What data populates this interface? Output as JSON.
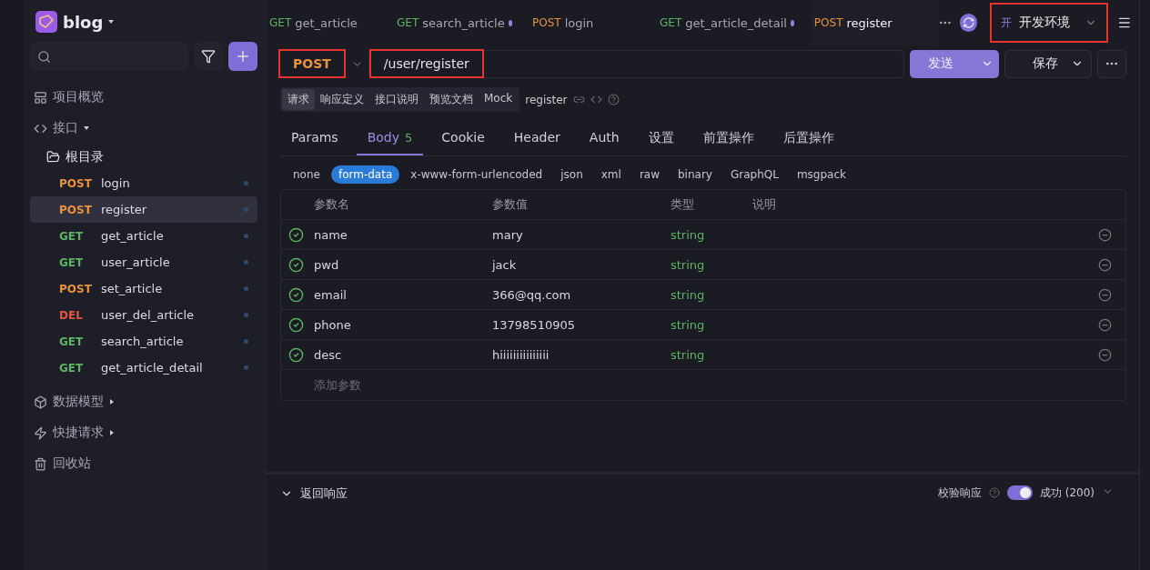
{
  "project": {
    "name": "blog"
  },
  "sidebar": {
    "nav": [
      {
        "label": "项目概览",
        "kind": "overview"
      },
      {
        "label": "接口",
        "kind": "api"
      }
    ],
    "folder": {
      "label": "根目录",
      "children": [
        {
          "method": "POST",
          "name": "login",
          "selected": false
        },
        {
          "method": "POST",
          "name": "register",
          "selected": true
        },
        {
          "method": "GET",
          "name": "get_article",
          "selected": false
        },
        {
          "method": "GET",
          "name": "user_article",
          "selected": false
        },
        {
          "method": "POST",
          "name": "set_article",
          "selected": false
        },
        {
          "method": "DEL",
          "name": "user_del_article",
          "selected": false
        },
        {
          "method": "GET",
          "name": "search_article",
          "selected": false
        },
        {
          "method": "GET",
          "name": "get_article_detail",
          "selected": false
        }
      ]
    },
    "sections": [
      {
        "label": "数据模型",
        "kind": "model"
      },
      {
        "label": "快捷请求",
        "kind": "quick"
      },
      {
        "label": "回收站",
        "kind": "trash"
      }
    ]
  },
  "tabs": [
    {
      "method": "GET",
      "name": "get_article",
      "modified": false,
      "selected": false
    },
    {
      "method": "GET",
      "name": "search_article",
      "modified": true,
      "selected": false
    },
    {
      "method": "POST",
      "name": "login",
      "modified": false,
      "selected": false
    },
    {
      "method": "GET",
      "name": "get_article_detail",
      "modified": true,
      "selected": false
    },
    {
      "method": "POST",
      "name": "register",
      "modified": false,
      "selected": true
    }
  ],
  "environment": {
    "badge": "开",
    "name": "开发环境",
    "highlighted": true
  },
  "request": {
    "method": {
      "value": "POST",
      "highlighted": true
    },
    "url": {
      "value": "/user/register",
      "highlighted": true
    },
    "send": "发送",
    "save": "保存"
  },
  "doc_tabs": [
    {
      "label": "请求",
      "selected": true
    },
    {
      "label": "响应定义",
      "selected": false
    },
    {
      "label": "接口说明",
      "selected": false
    },
    {
      "label": "预览文档",
      "selected": false
    },
    {
      "label": "Mock",
      "selected": false
    }
  ],
  "doc_name": "register",
  "param_tabs": [
    {
      "label": "Params",
      "selected": false
    },
    {
      "label": "Body",
      "count": "5",
      "selected": true
    },
    {
      "label": "Cookie",
      "selected": false
    },
    {
      "label": "Header",
      "selected": false
    },
    {
      "label": "Auth",
      "selected": false
    },
    {
      "label": "设置",
      "selected": false
    },
    {
      "label": "前置操作",
      "selected": false
    },
    {
      "label": "后置操作",
      "selected": false
    }
  ],
  "body_types": [
    {
      "label": "none",
      "selected": false
    },
    {
      "label": "form-data",
      "selected": true
    },
    {
      "label": "x-www-form-urlencoded",
      "selected": false
    },
    {
      "label": "json",
      "selected": false
    },
    {
      "label": "xml",
      "selected": false
    },
    {
      "label": "raw",
      "selected": false
    },
    {
      "label": "binary",
      "selected": false
    },
    {
      "label": "GraphQL",
      "selected": false
    },
    {
      "label": "msgpack",
      "selected": false
    }
  ],
  "table": {
    "columns": [
      "参数名",
      "参数值",
      "类型",
      "说明"
    ],
    "rows": [
      {
        "checked": true,
        "name": "name",
        "value": "mary",
        "type": "string"
      },
      {
        "checked": true,
        "name": "pwd",
        "value": "jack",
        "type": "string"
      },
      {
        "checked": true,
        "name": "email",
        "value": "366@qq.com",
        "type": "string"
      },
      {
        "checked": true,
        "name": "phone",
        "value": "13798510905",
        "type": "string"
      },
      {
        "checked": true,
        "name": "desc",
        "value": "hiiiiiiiiiiiiiii",
        "type": "string"
      }
    ],
    "add_placeholder": "添加参数"
  },
  "response": {
    "title": "返回响应",
    "validate_label": "校验响应",
    "validate_on": true,
    "status": "成功 (200)"
  }
}
